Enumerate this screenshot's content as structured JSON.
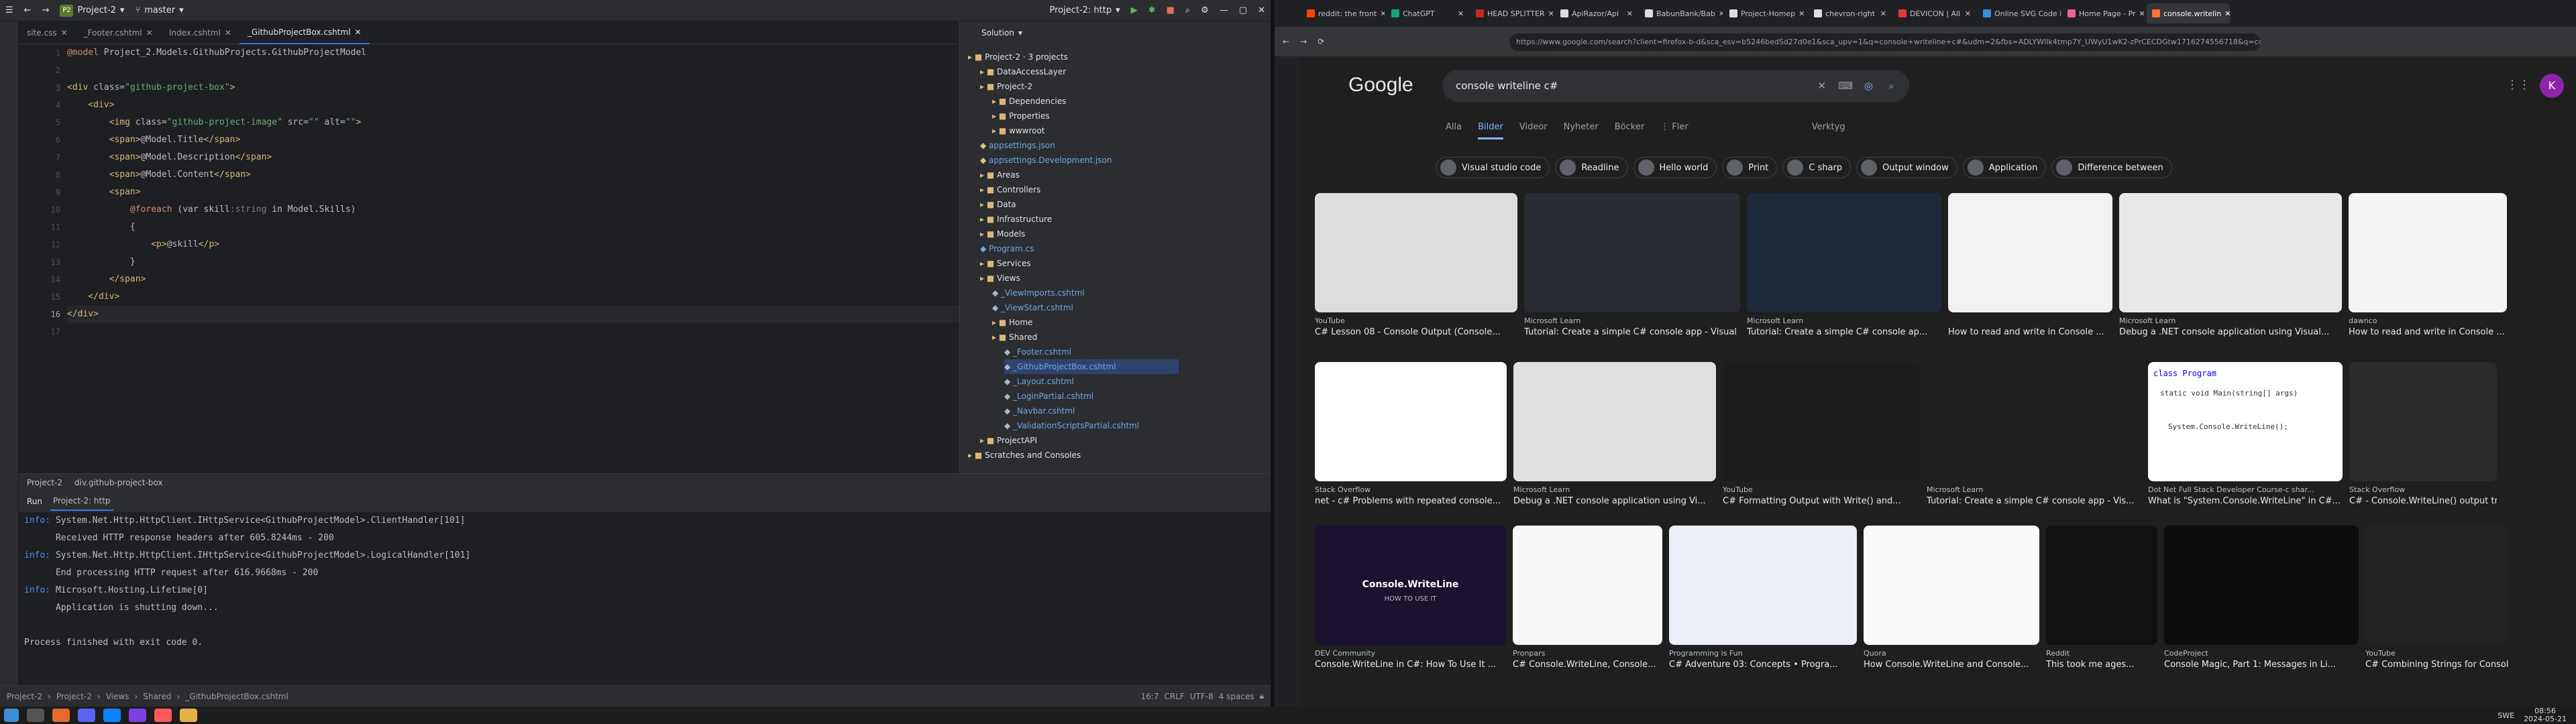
{
  "ide": {
    "project": "Project-2",
    "branch": "master",
    "badge": "P2",
    "run_config": "Project-2: http",
    "tabs": [
      "site.css",
      "_Footer.cshtml",
      "Index.cshtml",
      "_GithubProjectBox.cshtml"
    ],
    "solution_label": "Solution",
    "gutter": [
      "1",
      "2",
      "3",
      "4",
      "5",
      "6",
      "7",
      "8",
      "9",
      "10",
      "11",
      "12",
      "13",
      "14",
      "15",
      "16",
      "17"
    ],
    "code": {
      "l1a": "@model ",
      "l1b": "Project_2.Models.GithubProjects.GithubProjectModel",
      "l3a": "<div ",
      "l3b": "class=",
      "l3c": "\"github-project-box\"",
      "l3d": ">",
      "l4": "    <div>",
      "l5a": "        <img ",
      "l5b": "class=",
      "l5c": "\"github-project-image\"",
      "l5d": " src=",
      "l5e": "\"\"",
      "l5f": " alt=",
      "l5g": "\"\"",
      "l5h": ">",
      "l6a": "        <span>",
      "l6b": "@Model.Title",
      "l6c": "</span>",
      "l7a": "        <span>",
      "l7b": "@Model.Description",
      "l7c": "</span>",
      "l8a": "        <span>",
      "l8b": "@Model.Content",
      "l8c": "</span>",
      "l9": "        <span>",
      "l10a": "            @foreach ",
      "l10b": "(var skill",
      "l10c": ":string",
      "l10d": " in Model.Skills)",
      "l11": "            {",
      "l12a": "                <p>",
      "l12b": "@skill",
      "l12c": "</p>",
      "l13": "            }",
      "l14": "        </span>",
      "l15": "    </div>",
      "l16": "</div>"
    },
    "tree": [
      {
        "label": "Project-2 · 3 projects",
        "cls": "fold"
      },
      {
        "label": "DataAccessLayer",
        "cls": "fold"
      },
      {
        "label": "Project-2",
        "cls": "fold"
      },
      {
        "label": "Dependencies",
        "cls": "fold"
      },
      {
        "label": "Properties",
        "cls": "fold"
      },
      {
        "label": "wwwroot",
        "cls": "fold"
      },
      {
        "label": "appsettings.json",
        "cls": "json"
      },
      {
        "label": "appsettings.Development.json",
        "cls": "json"
      },
      {
        "label": "Areas",
        "cls": "fold"
      },
      {
        "label": "Controllers",
        "cls": "fold"
      },
      {
        "label": "Data",
        "cls": "fold"
      },
      {
        "label": "Infrastructure",
        "cls": "fold"
      },
      {
        "label": "Models",
        "cls": "fold"
      },
      {
        "label": "Program.cs",
        "cls": "cs"
      },
      {
        "label": "Services",
        "cls": "fold"
      },
      {
        "label": "Views",
        "cls": "fold"
      },
      {
        "label": "_ViewImports.cshtml",
        "cls": "razor"
      },
      {
        "label": "_ViewStart.cshtml",
        "cls": "razor"
      },
      {
        "label": "Home",
        "cls": "fold"
      },
      {
        "label": "Shared",
        "cls": "fold"
      },
      {
        "label": "_Footer.cshtml",
        "cls": "razor"
      },
      {
        "label": "_GithubProjectBox.cshtml",
        "cls": "razor"
      },
      {
        "label": "_Layout.cshtml",
        "cls": "razor"
      },
      {
        "label": "_LoginPartial.cshtml",
        "cls": "razor"
      },
      {
        "label": "_Navbar.cshtml",
        "cls": "razor"
      },
      {
        "label": "_ValidationScriptsPartial.cshtml",
        "cls": "razor"
      },
      {
        "label": "ProjectAPI",
        "cls": "fold"
      },
      {
        "label": "Scratches and Consoles",
        "cls": "fold"
      }
    ],
    "breadcrumb_bottom": [
      "Project-2",
      "div.github-project-box"
    ],
    "run_label": "Run",
    "run_tab": "Project-2: http",
    "console": [
      {
        "prefix": "info:",
        "text": " System.Net.Http.HttpClient.IHttpService<GithubProjectModel>.ClientHandler[101]"
      },
      {
        "prefix": "",
        "text": "      Received HTTP response headers after 605.8244ms - 200"
      },
      {
        "prefix": "info:",
        "text": " System.Net.Http.HttpClient.IHttpService<GithubProjectModel>.LogicalHandler[101]"
      },
      {
        "prefix": "",
        "text": "      End processing HTTP request after 616.9668ms - 200"
      },
      {
        "prefix": "info:",
        "text": " Microsoft.Hosting.Lifetime[0]"
      },
      {
        "prefix": "",
        "text": "      Application is shutting down..."
      },
      {
        "prefix": "",
        "text": ""
      },
      {
        "prefix": "",
        "text": "Process finished with exit code 0."
      }
    ],
    "status_path": [
      "Project-2",
      "Project-2",
      "Views",
      "Shared",
      "_GithubProjectBox.cshtml"
    ],
    "status_right": [
      "16:7",
      "CRLF",
      "UTF-8",
      "4 spaces"
    ]
  },
  "browser": {
    "tabs": [
      "reddit: the front",
      "ChatGPT",
      "HEAD SPLITTER",
      "ApiRazor/Api",
      "BabunBank/Bab",
      "Project-Homep",
      "chevron-right",
      "DEVICON | All",
      "Online SVG Code E",
      "Home Page - Pr",
      "console.writelin"
    ],
    "active_tab": 10,
    "url": "https://www.google.com/search?client=firefox-b-d&sca_esv=b5246bedSd27d0e1&sca_upv=1&q=console+writeline+c#&udm=2&fbs=ADLYWIIk4tmp7Y_UWyU1wK2-zPrCECDGtw1716274556718&q=console+writeline+c%23",
    "logo": "Google",
    "query": "console writeline c#",
    "nav": [
      "Alla",
      "Bilder",
      "Videor",
      "Nyheter",
      "Böcker",
      "⋮ Fler",
      "Verktyg"
    ],
    "nav_selected": 1,
    "chips": [
      "Visual studio code",
      "Readline",
      "Hello world",
      "Print",
      "C sharp",
      "Output window",
      "Application",
      "Difference between"
    ],
    "avatar": "K",
    "results": [
      {
        "src": "YouTube",
        "title": "C# Lesson 08 - Console Output (Console..."
      },
      {
        "src": "Microsoft Learn",
        "title": "Tutorial: Create a simple C# console app - Visual St..."
      },
      {
        "src": "Microsoft Learn",
        "title": "Tutorial: Create a simple C# console ap..."
      },
      {
        "src": "",
        "title": "How to read and write in Console ..."
      },
      {
        "src": "Microsoft Learn",
        "title": "Debug a .NET console application using Visual..."
      },
      {
        "src": "dawnco",
        "title": "How to read and write in Console ..."
      },
      {
        "src": "Stack Overflow",
        "title": "net - c# Problems with repeated console..."
      },
      {
        "src": "Microsoft Learn",
        "title": "Debug a .NET console application using Vi..."
      },
      {
        "src": "YouTube",
        "title": "C# Formatting Output with Write() and..."
      },
      {
        "src": "Microsoft Learn",
        "title": "Tutorial: Create a simple C# console app - Vis..."
      },
      {
        "src": "Dot Net Full Stack Developer Course-c shar...",
        "title": "What is \"System.Console.WriteLine\" in C#..."
      },
      {
        "src": "Stack Overflow",
        "title": "C# - Console.WriteLine() output truncate..."
      },
      {
        "src": "DEV Community",
        "title": "Console.WriteLine in C#: How To Use It ..."
      },
      {
        "src": "Pronpars",
        "title": "C# Console.WriteLine, Console..."
      },
      {
        "src": "Programming is Fun",
        "title": "C# Adventure 03: Concepts • Progra..."
      },
      {
        "src": "Quora",
        "title": "How Console.WriteLine and Console..."
      },
      {
        "src": "Reddit",
        "title": "This took me ages..."
      },
      {
        "src": "CodeProject",
        "title": "Console Magic, Part 1: Messages in Li..."
      },
      {
        "src": "YouTube",
        "title": "C# Combining Strings for Console.Writ..."
      }
    ],
    "overlay_texts": [
      "Console.WriteLine",
      "HOW TO USE IT",
      "class Program",
      "static void Main(string[] args)",
      "System.Console.WriteLine();"
    ]
  },
  "taskbar": {
    "time": "08:56",
    "date": "2024-05-21",
    "lang": "SWE"
  }
}
